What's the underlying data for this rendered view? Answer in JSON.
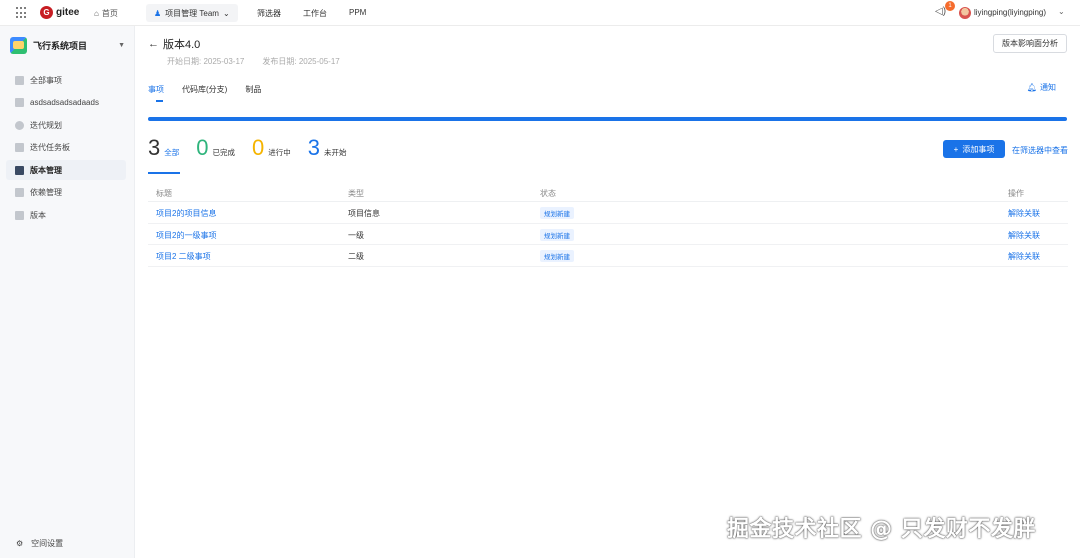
{
  "topbar": {
    "brand": "gitee",
    "home_label": "首页",
    "team_label": "项目管理 Team",
    "nav": [
      "筛选器",
      "工作台",
      "PPM"
    ],
    "notification_count": "1",
    "username": "liyingping(liyingping)"
  },
  "sidebar": {
    "project_name": "飞行系统项目",
    "items": [
      {
        "label": "全部事项"
      },
      {
        "label": "asdsadsadsadaads"
      },
      {
        "label": "迭代规划"
      },
      {
        "label": "迭代任务板"
      },
      {
        "label": "版本管理"
      },
      {
        "label": "依赖管理"
      },
      {
        "label": "版本"
      }
    ],
    "footer_label": "空间设置"
  },
  "version": {
    "title": "版本4.0",
    "start_date": "开始日期: 2025-03-17",
    "release_date": "发布日期: 2025-05-17",
    "impact_button": "版本影响面分析",
    "progress": 1.0
  },
  "tabs": [
    "事项",
    "代码库(分支)",
    "制品"
  ],
  "notify_label": "通知",
  "stats": {
    "all": {
      "count": "3",
      "label": "全部"
    },
    "done": {
      "count": "0",
      "label": "已完成"
    },
    "in_progress": {
      "count": "0",
      "label": "进行中"
    },
    "todo": {
      "count": "3",
      "label": "未开始"
    }
  },
  "actions": {
    "add_label": "添加事项",
    "filter_label": "在筛选器中查看"
  },
  "table": {
    "headers": [
      "标题",
      "类型",
      "状态",
      "操作"
    ],
    "rows": [
      {
        "title": "项目2的项目信息",
        "type": "项目信息",
        "status": "规划新建",
        "op": "解除关联"
      },
      {
        "title": "项目2的一级事项",
        "type": "一级",
        "status": "规划新建",
        "op": "解除关联"
      },
      {
        "title": "项目2 二级事项",
        "type": "二级",
        "status": "规划新建",
        "op": "解除关联"
      }
    ]
  },
  "watermark": "掘金技术社区 @ 只发财不发胖",
  "colors": {
    "accent": "#1a73e8",
    "done": "#2fb47c",
    "in_progress": "#f5b400"
  }
}
